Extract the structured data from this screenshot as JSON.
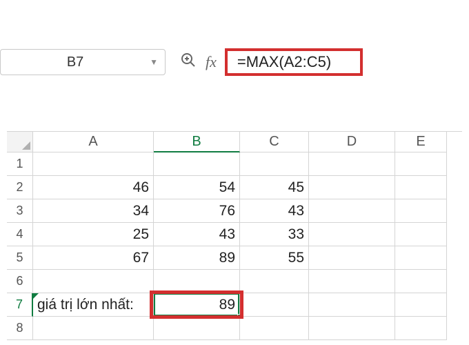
{
  "nameBox": {
    "value": "B7"
  },
  "formulaBar": {
    "value": "=MAX(A2:C5)"
  },
  "columns": [
    "A",
    "B",
    "C",
    "D",
    "E"
  ],
  "rows": [
    {
      "n": "1",
      "cells": [
        "",
        "",
        "",
        "",
        ""
      ]
    },
    {
      "n": "2",
      "cells": [
        "46",
        "54",
        "45",
        "",
        ""
      ]
    },
    {
      "n": "3",
      "cells": [
        "34",
        "76",
        "43",
        "",
        ""
      ]
    },
    {
      "n": "4",
      "cells": [
        "25",
        "43",
        "33",
        "",
        ""
      ]
    },
    {
      "n": "5",
      "cells": [
        "67",
        "89",
        "55",
        "",
        ""
      ]
    },
    {
      "n": "6",
      "cells": [
        "",
        "",
        "",
        "",
        ""
      ]
    },
    {
      "n": "7",
      "cells": [
        "giá trị lớn nhất:",
        "89",
        "",
        "",
        ""
      ]
    },
    {
      "n": "8",
      "cells": [
        "",
        "",
        "",
        "",
        ""
      ]
    }
  ],
  "activeCell": {
    "row": 7,
    "col": "B"
  },
  "chart_data": {
    "type": "table",
    "title": "",
    "series": [
      {
        "name": "A",
        "values": [
          46,
          34,
          25,
          67
        ]
      },
      {
        "name": "B",
        "values": [
          54,
          76,
          43,
          89
        ]
      },
      {
        "name": "C",
        "values": [
          45,
          43,
          33,
          55
        ]
      }
    ],
    "annotations": [
      {
        "label": "giá trị lớn nhất:",
        "value": 89,
        "formula": "=MAX(A2:C5)"
      }
    ]
  }
}
